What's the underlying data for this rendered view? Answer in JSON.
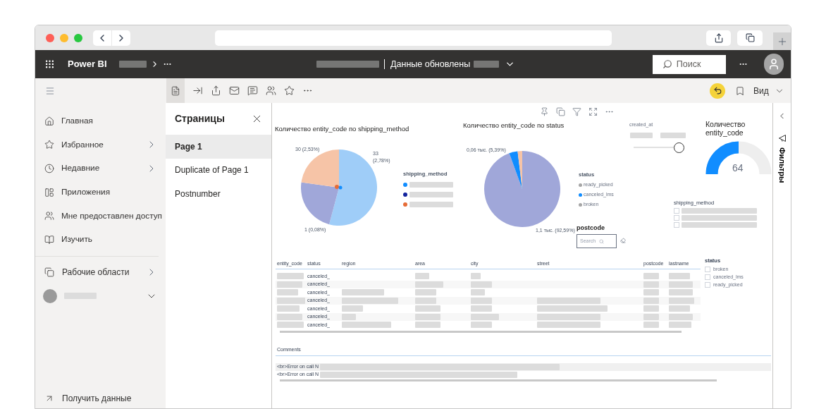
{
  "header": {
    "app_name": "Power BI",
    "refresh_label": "Данные обновлены",
    "search_placeholder": "Поиск"
  },
  "toolbar": {
    "view_label": "Вид"
  },
  "nav": {
    "items": [
      {
        "label": "Главная",
        "has_submenu": false
      },
      {
        "label": "Избранное",
        "has_submenu": true
      },
      {
        "label": "Недавние",
        "has_submenu": true
      },
      {
        "label": "Приложения",
        "has_submenu": false
      },
      {
        "label": "Мне предоставлен доступ",
        "has_submenu": false
      },
      {
        "label": "Изучить",
        "has_submenu": false
      }
    ],
    "workspaces": {
      "label": "Рабочие области",
      "has_submenu": true
    },
    "workspace": {
      "expanded": false
    },
    "get_data": "Получить данные"
  },
  "pages": {
    "title": "Страницы",
    "items": [
      {
        "label": "Page 1",
        "selected": true
      },
      {
        "label": "Duplicate of Page 1",
        "selected": false
      },
      {
        "label": "Postnumber",
        "selected": false
      }
    ]
  },
  "report": {
    "chart_1": {
      "title": "Количество entity_code по shipping_method",
      "data_labels": [
        "30 (2,53%)",
        "33",
        "(2,78%)",
        "1 (0,08%)"
      ]
    },
    "legend_1": {
      "title": "shipping_method",
      "items": [
        {
          "color": "#118dff"
        },
        {
          "color": "#12239e"
        },
        {
          "color": "#e66c37"
        }
      ]
    },
    "chart_2": {
      "title": "Количество entity_code по status",
      "data_labels": [
        "0,06 тыс. (5,39%)",
        "1,1 тыс. (92,59%)"
      ]
    },
    "legend_2": {
      "title": "status",
      "items": [
        {
          "label": "ready_picked",
          "color": "#a6a6a6"
        },
        {
          "label": "canceled_lms",
          "color": "#118dff"
        },
        {
          "label": "broken",
          "color": "#a6a6a6"
        }
      ]
    },
    "date_slicer": {
      "title": "created_at",
      "level": 1
    },
    "gauge": {
      "title": "Количество entity_code",
      "value": "64",
      "level": 0.5
    },
    "shipping_slicer": {
      "title": "shipping_method",
      "items": [
        {
          "checked": false
        },
        {
          "checked": false
        },
        {
          "checked": false
        }
      ]
    },
    "postcode_slicer": {
      "title": "postcode",
      "placeholder": "Search"
    },
    "table": {
      "columns": [
        "entity_code",
        "status",
        "region",
        "area",
        "city",
        "street",
        "postcode",
        "lastname"
      ],
      "rows": [
        {
          "status": "canceled_"
        },
        {
          "status": "canceled_"
        },
        {
          "status": "canceled_"
        },
        {
          "status": "canceled_"
        },
        {
          "status": "canceled_"
        },
        {
          "status": "canceled_"
        },
        {
          "status": "canceled_"
        }
      ]
    },
    "status_slicer": {
      "title": "status",
      "items": [
        {
          "label": "broken",
          "checked": false
        },
        {
          "label": "canceled_lms",
          "checked": false
        },
        {
          "label": "ready_picked",
          "checked": false
        }
      ]
    },
    "comments_table": {
      "columns": [
        "Comments"
      ],
      "rows": [
        "<br>Error on call N",
        "<br>Error on call N"
      ]
    }
  },
  "filters_pane": {
    "title": "Фильтры"
  }
}
